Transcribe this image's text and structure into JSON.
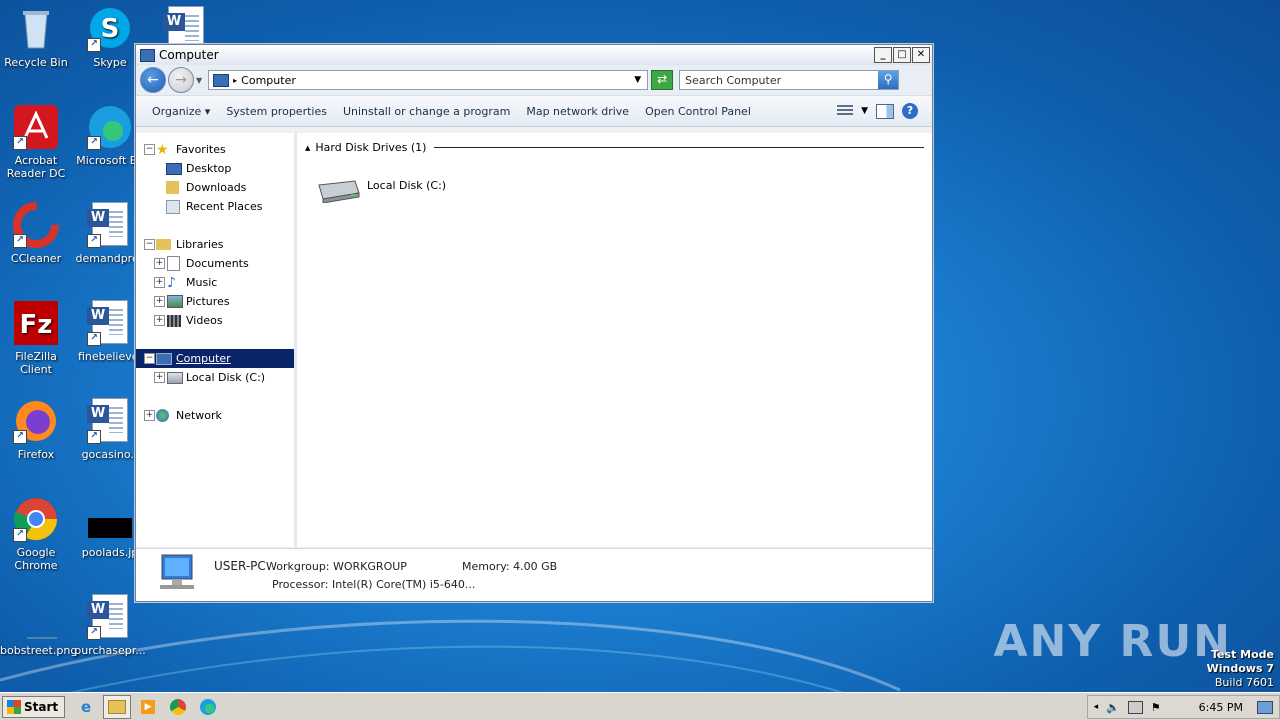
{
  "desktop": {
    "icons": [
      {
        "label": "Recycle Bin"
      },
      {
        "label": "Skype"
      },
      {
        "label": "Acrobat Reader DC"
      },
      {
        "label": "Microsoft Ed"
      },
      {
        "label": "CCleaner"
      },
      {
        "label": "demandpres"
      },
      {
        "label": "FileZilla Client"
      },
      {
        "label": "finebelieve."
      },
      {
        "label": "Firefox"
      },
      {
        "label": "gocasino.r"
      },
      {
        "label": "Google Chrome"
      },
      {
        "label": "poolads.jp"
      },
      {
        "label": "bobstreet.png"
      },
      {
        "label": "purchasepr..."
      }
    ]
  },
  "window": {
    "title": "Computer",
    "address": "Computer",
    "search_placeholder": "Search Computer",
    "toolbar": {
      "organize": "Organize",
      "system_properties": "System properties",
      "uninstall": "Uninstall or change a program",
      "map_drive": "Map network drive",
      "control_panel": "Open Control Panel"
    },
    "nav": {
      "favorites": "Favorites",
      "desktop": "Desktop",
      "downloads": "Downloads",
      "recent": "Recent Places",
      "libraries": "Libraries",
      "documents": "Documents",
      "music": "Music",
      "pictures": "Pictures",
      "videos": "Videos",
      "computer": "Computer",
      "local_disk": "Local Disk (C:)",
      "network": "Network"
    },
    "content": {
      "group_header": "Hard Disk Drives (1)",
      "drive_label": "Local Disk (C:)"
    },
    "status": {
      "pc_name": "USER-PC",
      "workgroup": "Workgroup: WORKGROUP",
      "memory": "Memory: 4.00 GB",
      "processor": "Processor: Intel(R) Core(TM) i5-640..."
    }
  },
  "taskbar": {
    "start": "Start",
    "clock": "6:45 PM"
  },
  "watermark": "ANY RUN",
  "test_mode": {
    "line1": "Test Mode",
    "line2": "Windows 7",
    "line3": "Build 7601"
  }
}
